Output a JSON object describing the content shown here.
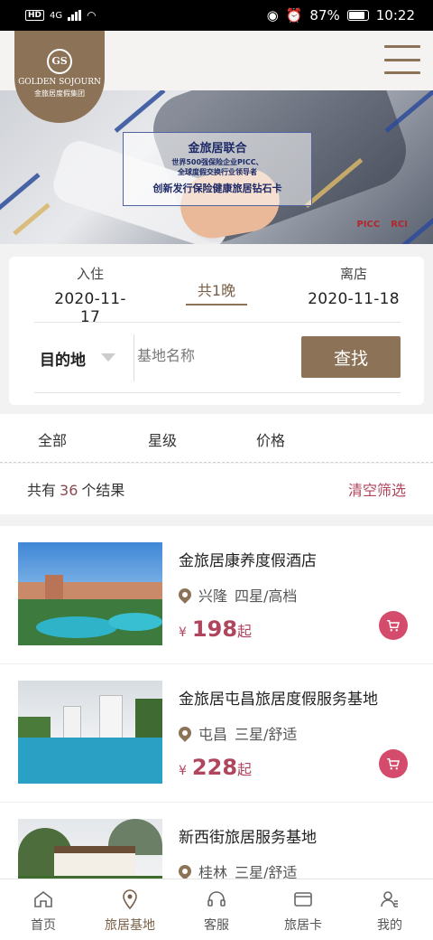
{
  "status_bar": {
    "network_badge": "HD",
    "network_type": "4G",
    "battery": "87%",
    "battery_level": 0.87,
    "time": "10:22"
  },
  "header": {
    "logo_emblem": "GS",
    "logo_line1": "GOLDEN SOJOURN",
    "logo_line2": "金旅居度假集团",
    "menu_icon": "hamburger-icon"
  },
  "banner": {
    "title": "金旅居联合",
    "line1": "世界500强保险企业PICC、",
    "line2": "全球度假交换行业领导者",
    "slogan": "创新发行保险健康旅居钻石卡",
    "logos": [
      "PICC",
      "RCI"
    ]
  },
  "search": {
    "checkin_label": "入住",
    "checkin_date": "2020-11-17",
    "nights": "共1晚",
    "checkout_label": "离店",
    "checkout_date": "2020-11-18",
    "destination_label": "目的地",
    "placeholder": "基地名称",
    "button": "查找"
  },
  "filters": {
    "tabs": [
      "全部",
      "星级",
      "价格"
    ]
  },
  "results": {
    "prefix": "共有",
    "count": "36",
    "suffix": "个结果",
    "clear": "清空筛选"
  },
  "listings": [
    {
      "name": "金旅居康养度假酒店",
      "city": "兴隆",
      "grade": "四星/高档",
      "currency": "¥",
      "price": "198",
      "price_suffix": "起"
    },
    {
      "name": "金旅居屯昌旅居度假服务基地",
      "city": "屯昌",
      "grade": "三星/舒适",
      "currency": "¥",
      "price": "228",
      "price_suffix": "起"
    },
    {
      "name": "新西街旅居服务基地",
      "city": "桂林",
      "grade": "三星/舒适"
    }
  ],
  "bottom_nav": [
    {
      "label": "首页",
      "icon": "home-icon"
    },
    {
      "label": "旅居基地",
      "icon": "location-icon",
      "active": true
    },
    {
      "label": "客服",
      "icon": "headset-icon"
    },
    {
      "label": "旅居卡",
      "icon": "card-icon"
    },
    {
      "label": "我的",
      "icon": "user-icon"
    }
  ],
  "colors": {
    "brand": "#8c7358",
    "price": "#b0465d",
    "cart": "#d44b6c"
  }
}
